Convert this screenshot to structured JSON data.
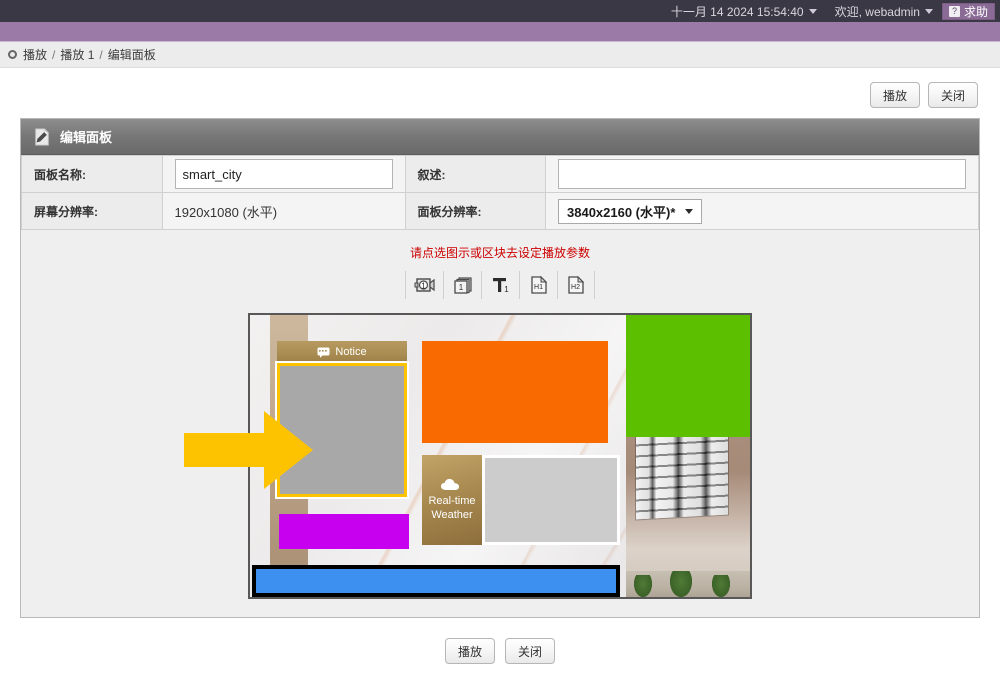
{
  "topbar": {
    "datetime": "十一月 14 2024 15:54:40",
    "user_greeting": "欢迎, webadmin",
    "help_label": "求助",
    "help_icon_char": "?"
  },
  "breadcrumb": {
    "items": [
      "播放",
      "播放 1",
      "编辑面板"
    ],
    "separator": "/"
  },
  "top_actions": {
    "play_label": "播放",
    "close_label": "关闭"
  },
  "panel": {
    "title": "编辑面板",
    "icon": "edit-pencil-icon",
    "fields": {
      "panel_name_label": "面板名称:",
      "panel_name_value": "smart_city",
      "description_label": "叙述:",
      "description_value": "",
      "screen_resolution_label": "屏幕分辨率:",
      "screen_resolution_value": "1920x1080 (水平)",
      "panel_resolution_label": "面板分辨率:",
      "panel_resolution_value": "3840x2160 (水平)*"
    }
  },
  "editor": {
    "hint": "请点选图示或区块去设定播放参数",
    "toolbar": [
      {
        "name": "video-source-1-icon",
        "label": "1",
        "kind": "camera"
      },
      {
        "name": "image-stack-1-icon",
        "label": "1",
        "kind": "images"
      },
      {
        "name": "text-ticker-1-icon",
        "label": "1",
        "kind": "text"
      },
      {
        "name": "html-page-h1-icon",
        "label": "H1",
        "kind": "page"
      },
      {
        "name": "html-page-h2-icon",
        "label": "H2",
        "kind": "page"
      }
    ],
    "canvas": {
      "notice_widget": {
        "title": "Notice",
        "header_color": "#a98c52",
        "body_color": "#a8a8a8",
        "selection_color": "#fdc300"
      },
      "weather_widget": {
        "title_line1": "Real-time",
        "title_line2": "Weather",
        "panel_color": "#a88b52",
        "body_color": "#cccccc"
      },
      "blocks": [
        {
          "name": "orange-block",
          "color": "#f96a00"
        },
        {
          "name": "green-block",
          "color": "#5cc000"
        },
        {
          "name": "magenta-block",
          "color": "#c800f0"
        },
        {
          "name": "blue-ticker-block",
          "color": "#3d90f0",
          "frame_color": "#000000"
        }
      ],
      "pointer": {
        "name": "arrow-pointer",
        "color": "#fdc300"
      }
    }
  },
  "bottom_actions": {
    "play_label": "播放",
    "close_label": "关闭"
  }
}
